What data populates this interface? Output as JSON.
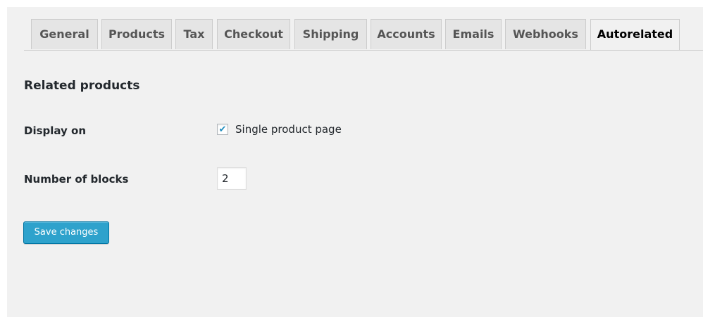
{
  "tabs": [
    {
      "label": "General"
    },
    {
      "label": "Products"
    },
    {
      "label": "Tax"
    },
    {
      "label": "Checkout"
    },
    {
      "label": "Shipping"
    },
    {
      "label": "Accounts"
    },
    {
      "label": "Emails"
    },
    {
      "label": "Webhooks"
    },
    {
      "label": "Autorelated",
      "active": true
    }
  ],
  "section": {
    "title": "Related products"
  },
  "fields": {
    "display_on": {
      "label": "Display on",
      "checkbox_label": "Single product page",
      "checked": true
    },
    "number_of_blocks": {
      "label": "Number of blocks",
      "value": "2"
    }
  },
  "actions": {
    "save_label": "Save changes"
  },
  "colors": {
    "accent": "#2ea2cc",
    "background": "#f1f1f1",
    "checkmark": "#1e8cbe"
  }
}
